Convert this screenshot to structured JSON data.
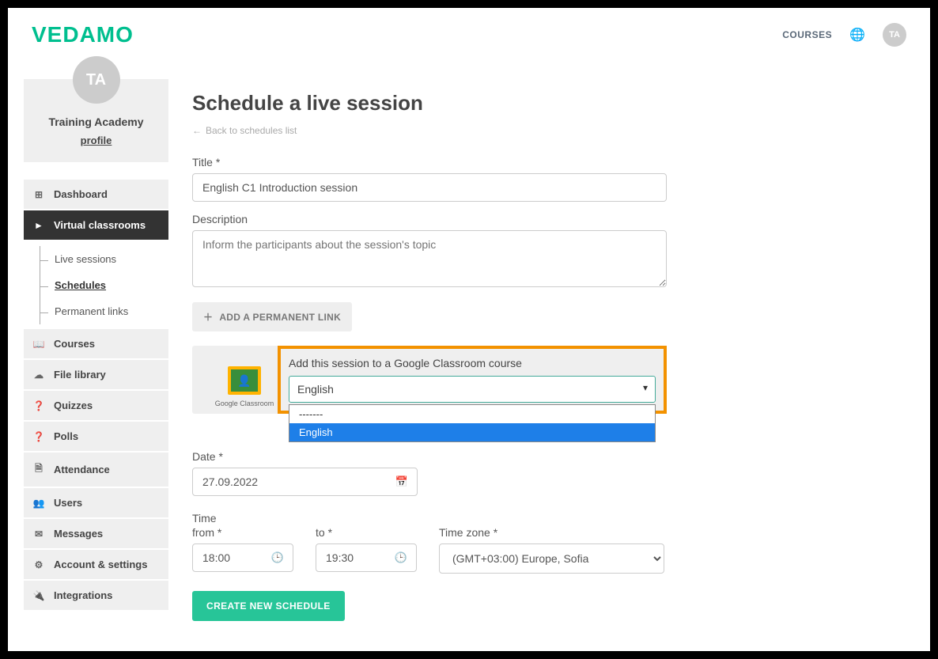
{
  "brand": "VEDAMO",
  "topnav": {
    "courses": "COURSES",
    "avatar_initials": "TA"
  },
  "profile": {
    "avatar_initials": "TA",
    "org_name": "Training Academy",
    "profile_link": "profile"
  },
  "sidebar": {
    "items": [
      {
        "label": "Dashboard",
        "icon": "⊞"
      },
      {
        "label": "Virtual classrooms",
        "icon": "►",
        "active": true,
        "sub": [
          {
            "label": "Live sessions"
          },
          {
            "label": "Schedules",
            "active": true
          },
          {
            "label": "Permanent links"
          }
        ]
      },
      {
        "label": "Courses",
        "icon": "📖"
      },
      {
        "label": "File library",
        "icon": "☁"
      },
      {
        "label": "Quizzes",
        "icon": "❓"
      },
      {
        "label": "Polls",
        "icon": "❓"
      },
      {
        "label": "Attendance",
        "icon": "🗎"
      },
      {
        "label": "Users",
        "icon": "👥"
      },
      {
        "label": "Messages",
        "icon": "✉"
      },
      {
        "label": "Account & settings",
        "icon": "⚙"
      },
      {
        "label": "Integrations",
        "icon": "🔌"
      }
    ]
  },
  "page": {
    "title": "Schedule a live session",
    "back_link": "Back to schedules list",
    "title_label": "Title *",
    "title_value": "English C1 Introduction session",
    "desc_label": "Description",
    "desc_placeholder": "Inform the participants about the session's topic",
    "perm_link_btn": "ADD A PERMANENT LINK",
    "gc": {
      "icon_label": "Google Classroom",
      "title": "Add this session to a Google Classroom course",
      "selected": "English",
      "options": [
        "-------",
        "English"
      ]
    },
    "date_label": "Date *",
    "date_value": "27.09.2022",
    "time_heading": "Time",
    "time_from_label": "from *",
    "time_from_value": "18:00",
    "time_to_label": "to *",
    "time_to_value": "19:30",
    "tz_label": "Time zone *",
    "tz_value": "(GMT+03:00) Europe, Sofia",
    "create_btn": "CREATE NEW SCHEDULE"
  }
}
